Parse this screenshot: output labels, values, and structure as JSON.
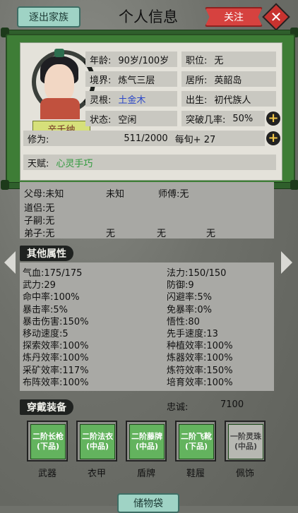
{
  "header": {
    "exit_label": "逐出家族",
    "title": "个人信息",
    "follow_label": "关注",
    "close_symbol": "✕"
  },
  "profile": {
    "name": "辛千纳",
    "age_label": "年龄:",
    "age_value": "90岁/100岁",
    "position_label": "职位:",
    "position_value": "无",
    "realm_label": "境界:",
    "realm_value": "炼气三层",
    "residence_label": "居所:",
    "residence_value": "英韶岛",
    "root_label": "灵根:",
    "root_value": "土金木",
    "birth_label": "出生:",
    "birth_value": "初代族人",
    "status_label": "状态:",
    "status_value": "空闲",
    "breakthrough_label": "突破几率:",
    "breakthrough_value": "50%",
    "cultivation_label": "修为:",
    "cultivation_value": "511/2000",
    "cultivation_rate": "每旬+ 27",
    "talent_label": "天赋:",
    "talent_value": "心灵手巧"
  },
  "relations": {
    "parents_label": "父母:",
    "parents_values": [
      "未知",
      "未知"
    ],
    "master_label": "师傅:",
    "master_value": "无",
    "spouse_label": "道侣:",
    "spouse_value": "无",
    "heir_label": "子嗣:",
    "heir_value": "无",
    "disciple_label": "弟子:",
    "disciple_values": [
      "无",
      "无",
      "无",
      "无"
    ]
  },
  "attributes": {
    "section_title": "其他属性",
    "left": [
      {
        "k": "气血:",
        "v": "175/175"
      },
      {
        "k": "武力:",
        "v": "29"
      },
      {
        "k": "命中率:",
        "v": "100%"
      },
      {
        "k": "暴击率:",
        "v": "5%"
      },
      {
        "k": "暴击伤害:",
        "v": "150%"
      },
      {
        "k": "移动速度:",
        "v": "5"
      },
      {
        "k": "探索效率:",
        "v": "100%"
      },
      {
        "k": "炼丹效率:",
        "v": "100%"
      },
      {
        "k": "采矿效率:",
        "v": "117%"
      },
      {
        "k": "布阵效率:",
        "v": "100%"
      }
    ],
    "right": [
      {
        "k": "法力:",
        "v": "150/150"
      },
      {
        "k": "防御:",
        "v": "9"
      },
      {
        "k": "闪避率:",
        "v": "5%"
      },
      {
        "k": "免暴率:",
        "v": "0%"
      },
      {
        "k": "悟性:",
        "v": "80"
      },
      {
        "k": "先手速度:",
        "v": "13"
      },
      {
        "k": "种植效率:",
        "v": "100%"
      },
      {
        "k": "炼器效率:",
        "v": "100%"
      },
      {
        "k": "炼符效率:",
        "v": "150%"
      },
      {
        "k": "培育效率:",
        "v": "100%"
      }
    ]
  },
  "equipment": {
    "section_title": "穿戴装备",
    "loyalty_label": "忠诚:",
    "loyalty_value": "7100",
    "slots": [
      {
        "line1": "二阶长枪",
        "line2": "(下品)",
        "label": "武器"
      },
      {
        "line1": "二阶法衣",
        "line2": "(中品)",
        "label": "衣甲"
      },
      {
        "line1": "二阶藤牌",
        "line2": "(中品)",
        "label": "盾牌"
      },
      {
        "line1": "二阶飞靴",
        "line2": "(下品)",
        "label": "鞋履"
      },
      {
        "line1": "一阶灵珠",
        "line2": "(中品)",
        "label": "佩饰"
      }
    ]
  },
  "footer": {
    "bag_label": "储物袋"
  },
  "colors": {
    "accent_green": "#3e7d36",
    "follow_red": "#d6423f",
    "teal_button": "#9fd3c5"
  }
}
